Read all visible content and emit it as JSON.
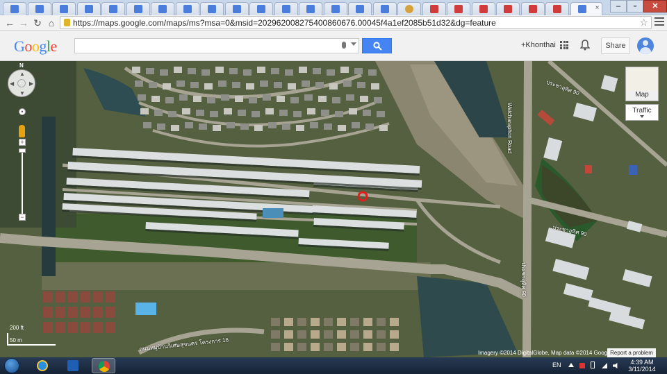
{
  "browser": {
    "tabs": [
      {
        "favicon": "google-maps-icon",
        "kind": "g"
      },
      {
        "favicon": "google-maps-icon",
        "kind": "g"
      },
      {
        "favicon": "google-maps-icon",
        "kind": "g"
      },
      {
        "favicon": "google-maps-icon",
        "kind": "g"
      },
      {
        "favicon": "google-maps-icon",
        "kind": "g"
      },
      {
        "favicon": "google-maps-icon",
        "kind": "g"
      },
      {
        "favicon": "google-maps-icon",
        "kind": "g"
      },
      {
        "favicon": "google-maps-icon",
        "kind": "g"
      },
      {
        "favicon": "google-maps-icon",
        "kind": "g"
      },
      {
        "favicon": "google-maps-icon",
        "kind": "g"
      },
      {
        "favicon": "google-maps-icon",
        "kind": "g"
      },
      {
        "favicon": "google-maps-icon",
        "kind": "g"
      },
      {
        "favicon": "google-maps-icon",
        "kind": "g"
      },
      {
        "favicon": "google-maps-icon",
        "kind": "g"
      },
      {
        "favicon": "google-maps-icon",
        "kind": "g"
      },
      {
        "favicon": "google-maps-icon",
        "kind": "g"
      },
      {
        "favicon": "site-icon",
        "kind": "o"
      },
      {
        "favicon": "shop-icon",
        "kind": "r"
      },
      {
        "favicon": "shop-icon",
        "kind": "r"
      },
      {
        "favicon": "shop-icon",
        "kind": "r"
      },
      {
        "favicon": "shop-icon",
        "kind": "r"
      },
      {
        "favicon": "shop-icon",
        "kind": "r"
      },
      {
        "favicon": "shop-icon",
        "kind": "r"
      },
      {
        "favicon": "google-maps-icon",
        "kind": "g",
        "active": true
      }
    ],
    "url": "https://maps.google.com/maps/ms?msa=0&msid=202962008275400860676.00045f4a1ef2085b51d32&dg=feature",
    "close_glyph": "×"
  },
  "google_bar": {
    "logo": "Google",
    "logo_colors": [
      "#4285f4",
      "#ea4335",
      "#fbbc05",
      "#4285f4",
      "#34a853",
      "#ea4335"
    ],
    "search_value": "",
    "user_name": "+Khonthai",
    "share_label": "Share"
  },
  "map": {
    "compass_north": "N",
    "map_type_label": "Map",
    "traffic_label": "Traffic",
    "scale_ft": "200 ft",
    "scale_m": "50 m",
    "attribution": "Imagery ©2014 DigitalGlobe, Map data ©2014 Google -",
    "report_label": "Report a problem",
    "road_labels": {
      "vertical_road": "Watcharaphon Road",
      "soi_90_upper": "ประชาอุทิศ 90",
      "soi_90_lower": "ประชาอุทิศ 90",
      "soi_90_vertical": "ประชาอุทิศ 90",
      "village_road": "ถนนหมู่บ้านวิเศษสุขนคร โครงการ 16"
    },
    "marker_color": "#e01f1f"
  },
  "taskbar": {
    "language": "EN",
    "time": "4:39 AM",
    "date": "3/11/2014"
  }
}
